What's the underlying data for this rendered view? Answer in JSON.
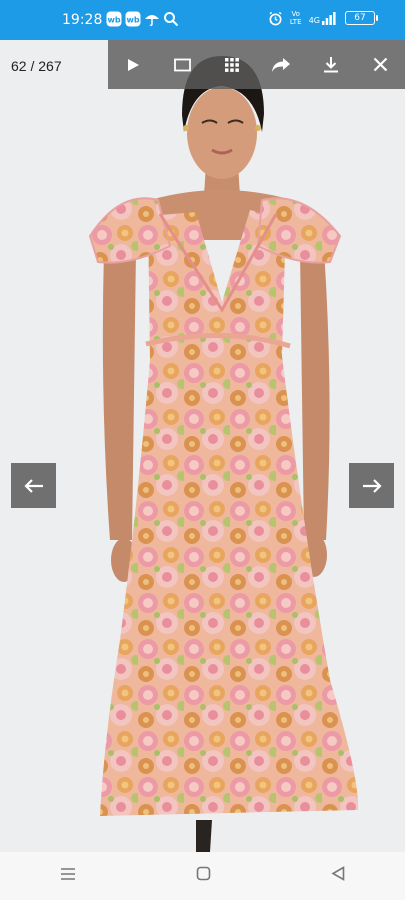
{
  "status_bar": {
    "time": "19:28",
    "left_icons": [
      "wb-app-icon",
      "wb-app-icon",
      "umbrella-icon",
      "search-icon"
    ],
    "right_icons": [
      "alarm-icon",
      "volte-icon",
      "signal-4g-icon",
      "battery-icon"
    ],
    "volte_label": "Vo LTE",
    "network_label": "4G",
    "battery_level": "67",
    "color": "#1e9be6"
  },
  "viewer": {
    "counter": "62 / 267",
    "toolbar": {
      "buttons": [
        "play-icon",
        "fullscreen-icon",
        "grid-icon",
        "share-icon",
        "download-icon",
        "close-icon"
      ]
    },
    "prev_icon": "arrow-left-icon",
    "next_icon": "arrow-right-icon",
    "image_subject": "woman wearing a floral ruffle-sleeve maxi dress"
  },
  "system_nav": {
    "buttons": [
      "menu-icon",
      "home-icon",
      "back-icon"
    ]
  }
}
